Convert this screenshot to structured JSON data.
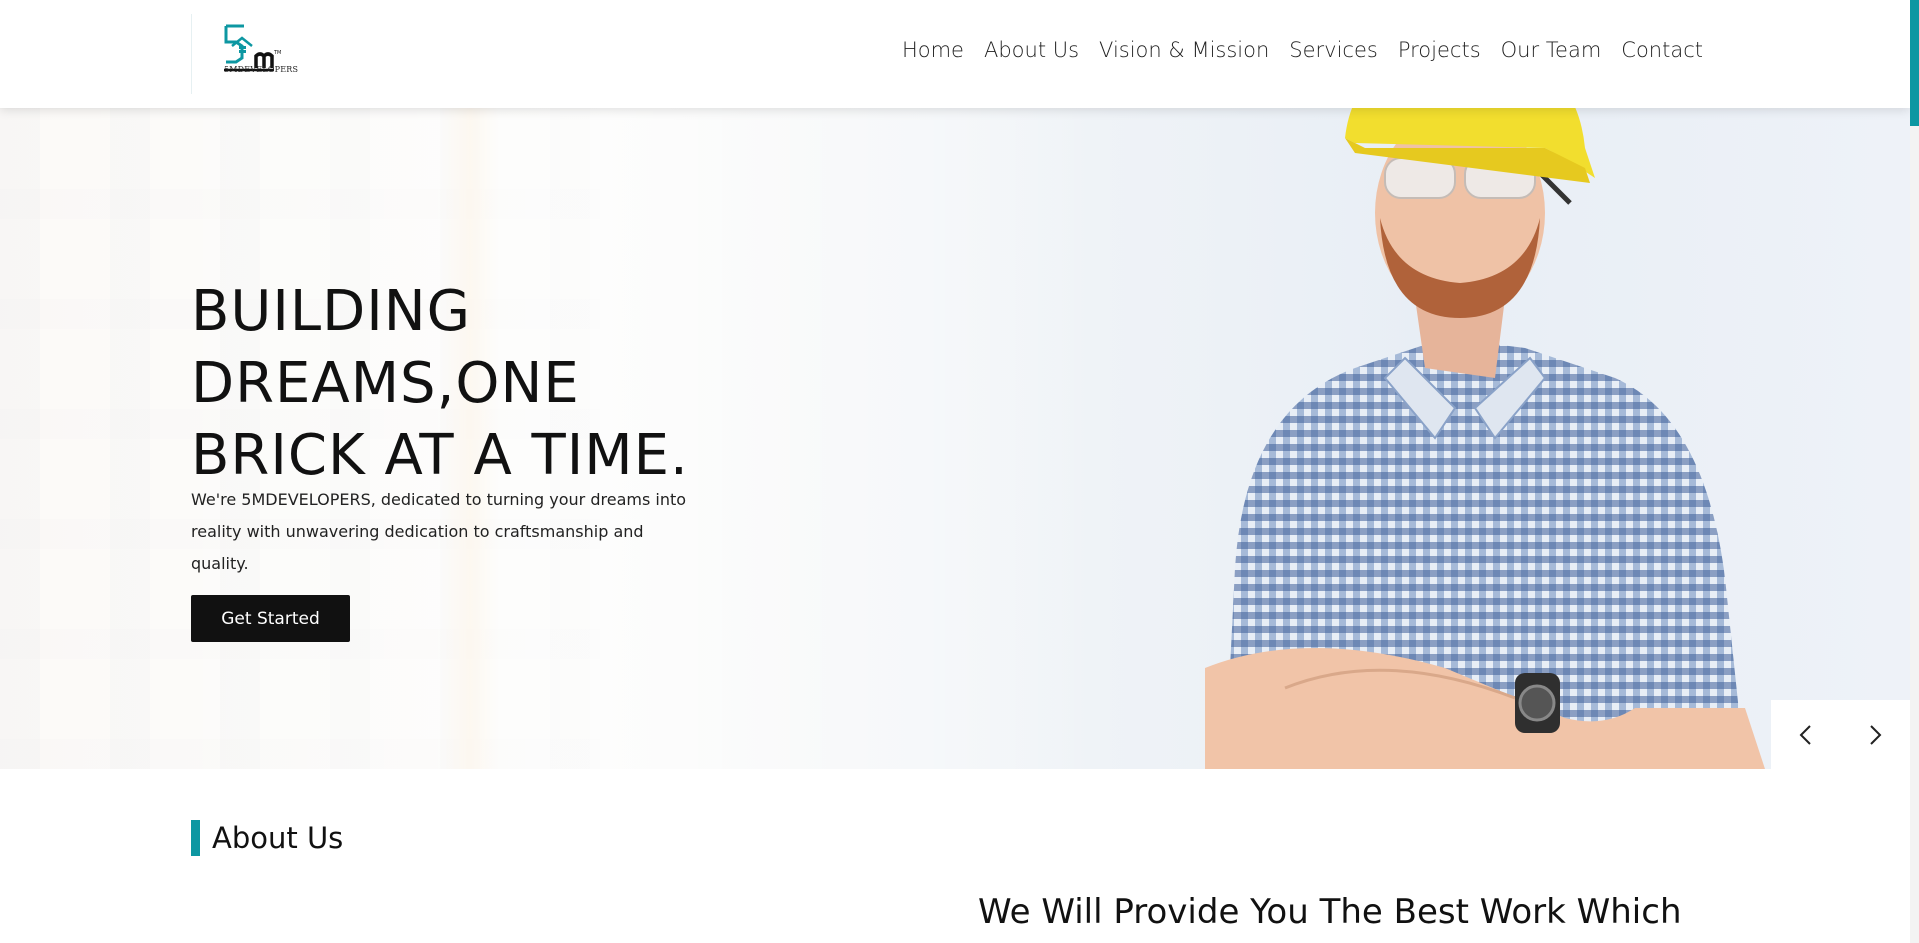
{
  "brand": {
    "logo_text": "5MDEVELOPERS",
    "accent_color": "#0d97a2"
  },
  "nav": {
    "items": [
      {
        "label": "Home",
        "name": "nav-home"
      },
      {
        "label": "About Us",
        "name": "nav-about-us"
      },
      {
        "label": "Vision & Mission",
        "name": "nav-vision-mission"
      },
      {
        "label": "Services",
        "name": "nav-services"
      },
      {
        "label": "Projects",
        "name": "nav-projects"
      },
      {
        "label": "Our Team",
        "name": "nav-our-team"
      },
      {
        "label": "Contact",
        "name": "nav-contact"
      }
    ]
  },
  "hero": {
    "title_lines": [
      "BUILDING",
      "DREAMS,ONE",
      "BRICK AT A TIME."
    ],
    "description": "We're 5MDEVELOPERS, dedicated to turning your dreams into reality with unwavering dedication to craftsmanship and quality.",
    "cta_label": "Get Started",
    "prev_icon": "chevron-left-icon",
    "next_icon": "chevron-right-icon"
  },
  "about": {
    "heading": "About Us",
    "subheading": "We Will Provide You The Best Work Which"
  }
}
